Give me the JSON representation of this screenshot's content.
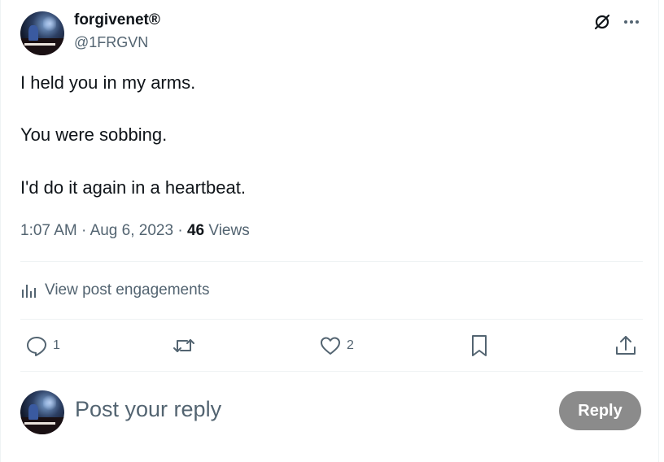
{
  "author": {
    "display_name": "forgivenet®",
    "handle": "@1FRGVN"
  },
  "tweet": {
    "lines": [
      "I held you in my arms.",
      "You were sobbing.",
      "I'd do it again in a heartbeat."
    ],
    "time": "1:07 AM",
    "sep": "·",
    "date": "Aug 6, 2023",
    "views_count": "46",
    "views_label": "Views"
  },
  "engagements": {
    "label": "View post engagements"
  },
  "actions": {
    "reply_count": "1",
    "repost_count": "",
    "like_count": "2"
  },
  "composer": {
    "placeholder": "Post your reply",
    "reply_button": "Reply"
  },
  "colors": {
    "text": "#0f1419",
    "secondary": "#536471",
    "divider": "#eff3f4",
    "reply_button_bg": "#8b8b8b"
  }
}
